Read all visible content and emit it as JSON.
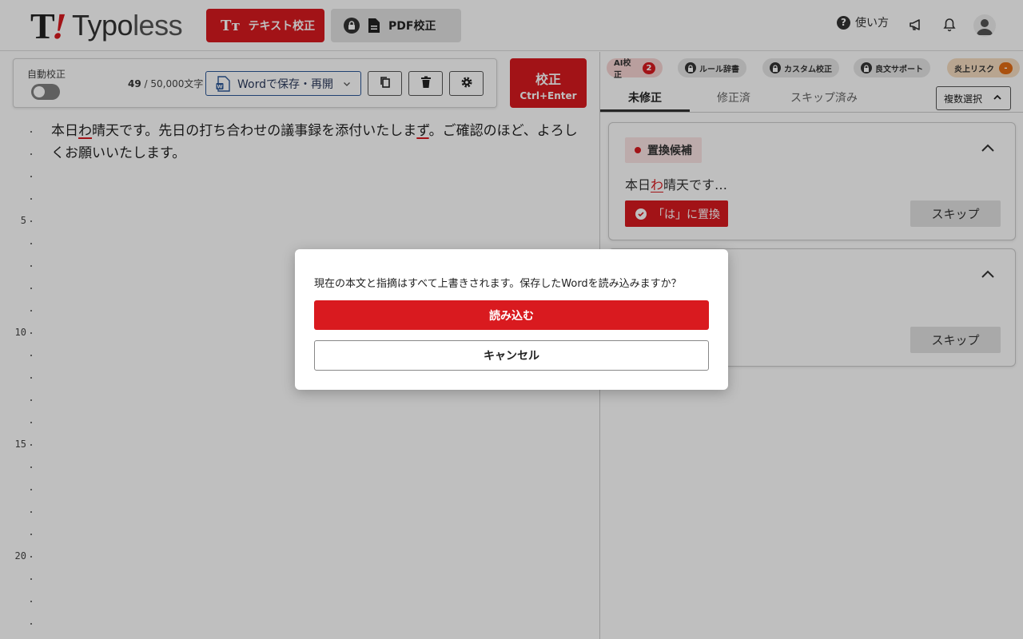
{
  "header": {
    "logo_mark": "T",
    "logo_text_bold": "Typo",
    "logo_text_light": "less",
    "modes": [
      {
        "label": "テキスト校正",
        "active": true
      },
      {
        "label": "PDF校正",
        "active": false
      }
    ],
    "help_label": "使い方",
    "brand_color": "#d91a1f"
  },
  "toolbar": {
    "auto_check_label": "自動校正",
    "auto_check_on": false,
    "char_count": "49",
    "char_separator": "/",
    "char_limit": "50,000文字",
    "word_button_label": "Wordで保存・再開",
    "check_button_label": "校正",
    "check_button_shortcut": "Ctrl+Enter"
  },
  "editor": {
    "line_numbers": [
      "5",
      "10",
      "15",
      "20"
    ],
    "text_part1": "本日",
    "text_err1": "わ",
    "text_part2": "晴天です。先日の打ち合わせの議事録を添付いたしま",
    "text_err2": "ず",
    "text_part3": "。ご確認のほど、よろしくお願いいたします。"
  },
  "right": {
    "chips": [
      {
        "label": "AI校正",
        "badge": "2"
      },
      {
        "label": "ルール辞書"
      },
      {
        "label": "カスタム校正"
      },
      {
        "label": "良文サポート"
      },
      {
        "label": "炎上リスク",
        "badge": "-"
      }
    ],
    "tabs": [
      "未修正",
      "修正済",
      "スキップ済み"
    ],
    "active_tab": "未修正",
    "multi_select_label": "複数選択",
    "cards": [
      {
        "category": "置換候補",
        "snippet_before": "本日",
        "snippet_highlight": "わ",
        "snippet_after": "晴天です…",
        "replace_label": "「は」に置換",
        "skip_label": "スキップ"
      },
      {
        "skip_label": "スキップ"
      }
    ]
  },
  "dialog": {
    "message": "現在の本文と指摘はすべて上書きされます。保存したWordを読み込みますか？",
    "confirm_label": "読み込む",
    "cancel_label": "キャンセル"
  }
}
